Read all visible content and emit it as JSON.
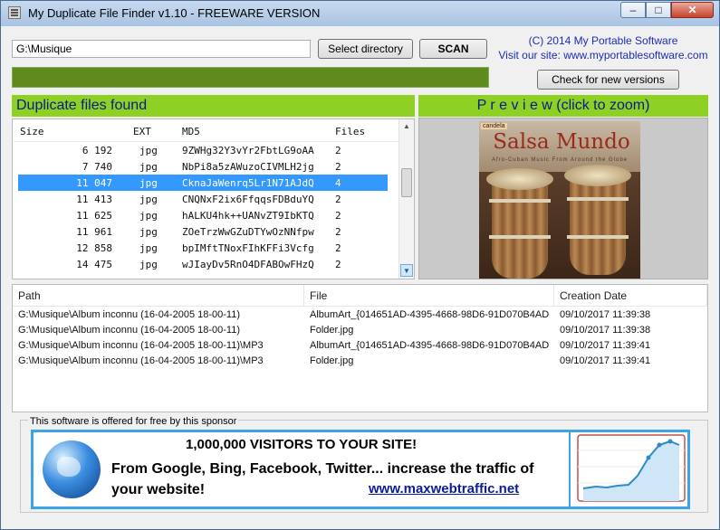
{
  "window": {
    "title": "My Duplicate File Finder v1.10 - FREEWARE VERSION",
    "controls": {
      "minimize": "–",
      "maximize": "□",
      "close": "✕"
    }
  },
  "toolbar": {
    "path_value": "G:\\Musique",
    "select_directory_label": "Select directory",
    "scan_label": "SCAN",
    "check_versions_label": "Check for new versions"
  },
  "copyright": {
    "line1": "(C) 2014 My Portable Software",
    "line2": "Visit our site: www.myportablesoftware.com"
  },
  "duplicates": {
    "header": "Duplicate files found",
    "columns": [
      "Size",
      "EXT",
      "MD5",
      "Files"
    ],
    "rows": [
      {
        "size": "6 192",
        "ext": "jpg",
        "md5": "9ZWHg32Y3vYr2FbtLG9oAA",
        "files": "2"
      },
      {
        "size": "7 740",
        "ext": "jpg",
        "md5": "NbPi8a5zAWuzoCIVMLH2jg",
        "files": "2"
      },
      {
        "size": "11 047",
        "ext": "jpg",
        "md5": "CknaJaWenrq5Lr1N71AJdQ",
        "files": "4",
        "selected": true
      },
      {
        "size": "11 413",
        "ext": "jpg",
        "md5": "CNQNxF2ix6FfqqsFDBduYQ",
        "files": "2"
      },
      {
        "size": "11 625",
        "ext": "jpg",
        "md5": "hALKU4hk++UANvZT9IbKTQ",
        "files": "2"
      },
      {
        "size": "11 961",
        "ext": "jpg",
        "md5": "ZOeTrzWwGZuDTYwOzNNfpw",
        "files": "2"
      },
      {
        "size": "12 858",
        "ext": "jpg",
        "md5": "bpIMftTNoxFIhKFFi3Vcfg",
        "files": "2"
      },
      {
        "size": "14 475",
        "ext": "jpg",
        "md5": "wJIayDv5RnO4DFABOwFHzQ",
        "files": "2"
      }
    ]
  },
  "preview": {
    "header": "P r e v i e w   (click to zoom)",
    "album_label": "candela",
    "album_title": "Salsa Mundo",
    "album_subtitle": "Afro-Cuban Music From Around the Globe"
  },
  "files": {
    "columns": [
      "Path",
      "File",
      "Creation Date"
    ],
    "rows": [
      {
        "path": "G:\\Musique\\Album inconnu (16-04-2005 18-00-11)",
        "file": "AlbumArt_{014651AD-4395-4668-98D6-91D070B4AD...",
        "date": "09/10/2017 11:39:38"
      },
      {
        "path": "G:\\Musique\\Album inconnu (16-04-2005 18-00-11)",
        "file": "Folder.jpg",
        "date": "09/10/2017 11:39:38"
      },
      {
        "path": "G:\\Musique\\Album inconnu (16-04-2005 18-00-11)\\MP3",
        "file": "AlbumArt_{014651AD-4395-4668-98D6-91D070B4AD...",
        "date": "09/10/2017 11:39:41"
      },
      {
        "path": "G:\\Musique\\Album inconnu (16-04-2005 18-00-11)\\MP3",
        "file": "Folder.jpg",
        "date": "09/10/2017 11:39:41"
      }
    ]
  },
  "sponsor": {
    "caption": "This software is offered for free by this sponsor",
    "headline": "1,000,000 VISITORS TO YOUR SITE!",
    "text": "From Google, Bing, Facebook, Twitter... increase the traffic of your website!",
    "link": "www.maxwebtraffic.net"
  },
  "colors": {
    "accent_green": "#8ed023",
    "header_text": "#0a1b8e",
    "selection": "#3399ff",
    "progress": "#5f8a1e",
    "link": "#1b2eb8"
  }
}
